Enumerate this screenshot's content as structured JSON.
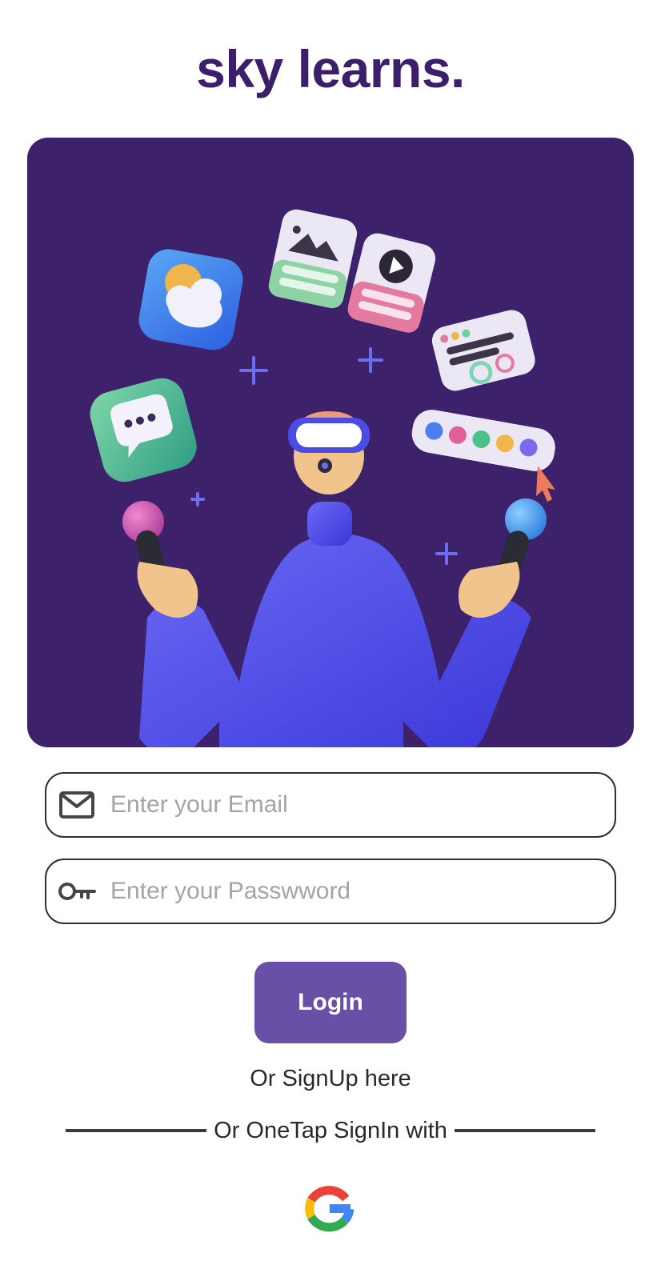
{
  "app": {
    "title": "sky learns."
  },
  "hero": {
    "illustration": "vr-person-juggling-app-icons"
  },
  "form": {
    "email": {
      "placeholder": "Enter your Email",
      "value": "",
      "icon": "mail-icon"
    },
    "password": {
      "placeholder": "Enter your Passwword",
      "value": "",
      "icon": "key-icon"
    },
    "login_label": "Login",
    "signup_text": "Or SignUp here",
    "onetap_text": "Or OneTap SignIn with"
  },
  "social": {
    "provider": "google-icon"
  },
  "colors": {
    "brand": "#3b1f6b",
    "hero_bg": "#3d216a",
    "button": "#6850a6",
    "field_border": "#2e2e33",
    "placeholder": "#a3a3a8"
  }
}
